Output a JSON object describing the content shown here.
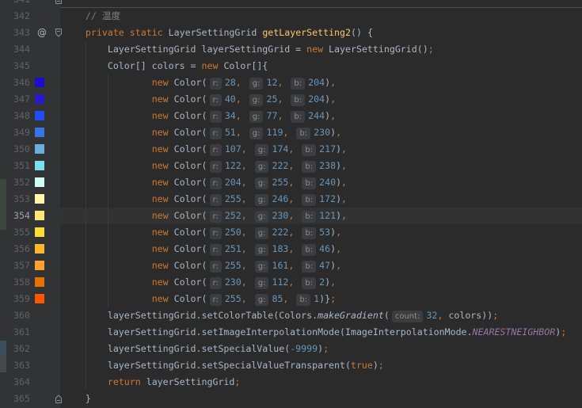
{
  "editor": {
    "current_line": "354",
    "colors": {
      "background": "#2B2B2B",
      "gutter": "#313335",
      "current_line_bg": "#323232",
      "line_number": "#606366",
      "current_line_number": "#A4A3A3",
      "hint_text": "#8C8C8C"
    },
    "syntax_colors": {
      "kw": "#CC7832",
      "punct": "#CC7832",
      "text": "#A9B7C6",
      "ws": "#A9B7C6",
      "num": "#6897BB",
      "comment": "#808080",
      "fn": "#FFC66D",
      "field": "#9876AA",
      "ital": "#A9B7C6",
      "hint": "#8C8C8C"
    },
    "lines": [
      {
        "num": "341",
        "fold": "fold-end-icon",
        "tokens": []
      },
      {
        "num": "342",
        "tokens": [
          [
            "ws",
            "    "
          ],
          [
            "comment",
            "// 温度"
          ]
        ]
      },
      {
        "num": "343",
        "gutter_icon": {
          "name": "at-icon",
          "glyph": "@"
        },
        "fold": "fold-start-icon",
        "tokens": [
          [
            "ws",
            "    "
          ],
          [
            "kw",
            "private"
          ],
          [
            "text",
            " "
          ],
          [
            "kw",
            "static"
          ],
          [
            "text",
            " LayerSettingGrid "
          ],
          [
            "fn",
            "getLayerSetting2"
          ],
          [
            "text",
            "() {"
          ]
        ]
      },
      {
        "num": "344",
        "tokens": [
          [
            "text",
            "        LayerSettingGrid layerSettingGrid = "
          ],
          [
            "kw",
            "new"
          ],
          [
            "text",
            " LayerSettingGrid()"
          ],
          [
            "punct",
            ";"
          ]
        ]
      },
      {
        "num": "345",
        "tokens": [
          [
            "text",
            "        Color[] colors = "
          ],
          [
            "kw",
            "new"
          ],
          [
            "text",
            " Color[]{"
          ]
        ]
      },
      {
        "num": "346",
        "swatch": "#1C0CCC",
        "tokens": [
          [
            "ws",
            "                "
          ],
          [
            "kw",
            "new"
          ],
          [
            "text",
            " Color("
          ],
          [
            "hint",
            "r:"
          ],
          [
            "num",
            "28"
          ],
          [
            "punct",
            ", "
          ],
          [
            "hint",
            "g:"
          ],
          [
            "num",
            "12"
          ],
          [
            "punct",
            ", "
          ],
          [
            "hint",
            "b:"
          ],
          [
            "num",
            "204"
          ],
          [
            "text",
            ")"
          ],
          [
            "punct",
            ","
          ]
        ]
      },
      {
        "num": "347",
        "swatch": "#2819CC",
        "tokens": [
          [
            "ws",
            "                "
          ],
          [
            "kw",
            "new"
          ],
          [
            "text",
            " Color("
          ],
          [
            "hint",
            "r:"
          ],
          [
            "num",
            "40"
          ],
          [
            "punct",
            ", "
          ],
          [
            "hint",
            "g:"
          ],
          [
            "num",
            "25"
          ],
          [
            "punct",
            ", "
          ],
          [
            "hint",
            "b:"
          ],
          [
            "num",
            "204"
          ],
          [
            "text",
            ")"
          ],
          [
            "punct",
            ","
          ]
        ]
      },
      {
        "num": "348",
        "swatch": "#224DF4",
        "tokens": [
          [
            "ws",
            "                "
          ],
          [
            "kw",
            "new"
          ],
          [
            "text",
            " Color("
          ],
          [
            "hint",
            "r:"
          ],
          [
            "num",
            "34"
          ],
          [
            "punct",
            ", "
          ],
          [
            "hint",
            "g:"
          ],
          [
            "num",
            "77"
          ],
          [
            "punct",
            ", "
          ],
          [
            "hint",
            "b:"
          ],
          [
            "num",
            "244"
          ],
          [
            "text",
            ")"
          ],
          [
            "punct",
            ","
          ]
        ]
      },
      {
        "num": "349",
        "swatch": "#3377E6",
        "tokens": [
          [
            "ws",
            "                "
          ],
          [
            "kw",
            "new"
          ],
          [
            "text",
            " Color("
          ],
          [
            "hint",
            "r:"
          ],
          [
            "num",
            "51"
          ],
          [
            "punct",
            ", "
          ],
          [
            "hint",
            "g:"
          ],
          [
            "num",
            "119"
          ],
          [
            "punct",
            ", "
          ],
          [
            "hint",
            "b:"
          ],
          [
            "num",
            "230"
          ],
          [
            "text",
            ")"
          ],
          [
            "punct",
            ","
          ]
        ]
      },
      {
        "num": "350",
        "swatch": "#6BAED9",
        "tokens": [
          [
            "ws",
            "                "
          ],
          [
            "kw",
            "new"
          ],
          [
            "text",
            " Color("
          ],
          [
            "hint",
            "r:"
          ],
          [
            "num",
            "107"
          ],
          [
            "punct",
            ", "
          ],
          [
            "hint",
            "g:"
          ],
          [
            "num",
            "174"
          ],
          [
            "punct",
            ", "
          ],
          [
            "hint",
            "b:"
          ],
          [
            "num",
            "217"
          ],
          [
            "text",
            ")"
          ],
          [
            "punct",
            ","
          ]
        ]
      },
      {
        "num": "351",
        "swatch": "#7ADEEE",
        "tokens": [
          [
            "ws",
            "                "
          ],
          [
            "kw",
            "new"
          ],
          [
            "text",
            " Color("
          ],
          [
            "hint",
            "r:"
          ],
          [
            "num",
            "122"
          ],
          [
            "punct",
            ", "
          ],
          [
            "hint",
            "g:"
          ],
          [
            "num",
            "222"
          ],
          [
            "punct",
            ", "
          ],
          [
            "hint",
            "b:"
          ],
          [
            "num",
            "238"
          ],
          [
            "text",
            ")"
          ],
          [
            "punct",
            ","
          ]
        ]
      },
      {
        "num": "352",
        "swatch": "#CCFFF0",
        "tokens": [
          [
            "ws",
            "                "
          ],
          [
            "kw",
            "new"
          ],
          [
            "text",
            " Color("
          ],
          [
            "hint",
            "r:"
          ],
          [
            "num",
            "204"
          ],
          [
            "punct",
            ", "
          ],
          [
            "hint",
            "g:"
          ],
          [
            "num",
            "255"
          ],
          [
            "punct",
            ", "
          ],
          [
            "hint",
            "b:"
          ],
          [
            "num",
            "240"
          ],
          [
            "text",
            ")"
          ],
          [
            "punct",
            ","
          ]
        ]
      },
      {
        "num": "353",
        "swatch": "#FFF6AC",
        "tokens": [
          [
            "ws",
            "                "
          ],
          [
            "kw",
            "new"
          ],
          [
            "text",
            " Color("
          ],
          [
            "hint",
            "r:"
          ],
          [
            "num",
            "255"
          ],
          [
            "punct",
            ", "
          ],
          [
            "hint",
            "g:"
          ],
          [
            "num",
            "246"
          ],
          [
            "punct",
            ", "
          ],
          [
            "hint",
            "b:"
          ],
          [
            "num",
            "172"
          ],
          [
            "text",
            ")"
          ],
          [
            "punct",
            ","
          ]
        ]
      },
      {
        "num": "354",
        "swatch": "#FCE679",
        "tokens": [
          [
            "ws",
            "                "
          ],
          [
            "kw",
            "new"
          ],
          [
            "text",
            " Color("
          ],
          [
            "hint",
            "r:"
          ],
          [
            "num",
            "252"
          ],
          [
            "punct",
            ", "
          ],
          [
            "hint",
            "g:"
          ],
          [
            "num",
            "230"
          ],
          [
            "punct",
            ", "
          ],
          [
            "hint",
            "b:"
          ],
          [
            "num",
            "121"
          ],
          [
            "text",
            ")"
          ],
          [
            "punct",
            ","
          ]
        ]
      },
      {
        "num": "355",
        "swatch": "#FADE35",
        "tokens": [
          [
            "ws",
            "                "
          ],
          [
            "kw",
            "new"
          ],
          [
            "text",
            " Color("
          ],
          [
            "hint",
            "r:"
          ],
          [
            "num",
            "250"
          ],
          [
            "punct",
            ", "
          ],
          [
            "hint",
            "g:"
          ],
          [
            "num",
            "222"
          ],
          [
            "punct",
            ", "
          ],
          [
            "hint",
            "b:"
          ],
          [
            "num",
            "53"
          ],
          [
            "text",
            ")"
          ],
          [
            "punct",
            ","
          ]
        ]
      },
      {
        "num": "356",
        "swatch": "#FBB72E",
        "tokens": [
          [
            "ws",
            "                "
          ],
          [
            "kw",
            "new"
          ],
          [
            "text",
            " Color("
          ],
          [
            "hint",
            "r:"
          ],
          [
            "num",
            "251"
          ],
          [
            "punct",
            ", "
          ],
          [
            "hint",
            "g:"
          ],
          [
            "num",
            "183"
          ],
          [
            "punct",
            ", "
          ],
          [
            "hint",
            "b:"
          ],
          [
            "num",
            "46"
          ],
          [
            "text",
            ")"
          ],
          [
            "punct",
            ","
          ]
        ]
      },
      {
        "num": "357",
        "swatch": "#FFA12F",
        "tokens": [
          [
            "ws",
            "                "
          ],
          [
            "kw",
            "new"
          ],
          [
            "text",
            " Color("
          ],
          [
            "hint",
            "r:"
          ],
          [
            "num",
            "255"
          ],
          [
            "punct",
            ", "
          ],
          [
            "hint",
            "g:"
          ],
          [
            "num",
            "161"
          ],
          [
            "punct",
            ", "
          ],
          [
            "hint",
            "b:"
          ],
          [
            "num",
            "47"
          ],
          [
            "text",
            ")"
          ],
          [
            "punct",
            ","
          ]
        ]
      },
      {
        "num": "358",
        "swatch": "#E67002",
        "tokens": [
          [
            "ws",
            "                "
          ],
          [
            "kw",
            "new"
          ],
          [
            "text",
            " Color("
          ],
          [
            "hint",
            "r:"
          ],
          [
            "num",
            "230"
          ],
          [
            "punct",
            ", "
          ],
          [
            "hint",
            "g:"
          ],
          [
            "num",
            "112"
          ],
          [
            "punct",
            ", "
          ],
          [
            "hint",
            "b:"
          ],
          [
            "num",
            "2"
          ],
          [
            "text",
            ")"
          ],
          [
            "punct",
            ","
          ]
        ]
      },
      {
        "num": "359",
        "swatch": "#FF5501",
        "tokens": [
          [
            "ws",
            "                "
          ],
          [
            "kw",
            "new"
          ],
          [
            "text",
            " Color("
          ],
          [
            "hint",
            "r:"
          ],
          [
            "num",
            "255"
          ],
          [
            "punct",
            ", "
          ],
          [
            "hint",
            "g:"
          ],
          [
            "num",
            "85"
          ],
          [
            "punct",
            ", "
          ],
          [
            "hint",
            "b:"
          ],
          [
            "num",
            "1"
          ],
          [
            "text",
            ")}"
          ],
          [
            "punct",
            ";"
          ]
        ]
      },
      {
        "num": "360",
        "tokens": [
          [
            "text",
            "        layerSettingGrid.setColorTable(Colors."
          ],
          [
            "ital",
            "makeGradient"
          ],
          [
            "text",
            "("
          ],
          [
            "hint",
            "count:"
          ],
          [
            "num",
            "32"
          ],
          [
            "punct",
            ", "
          ],
          [
            "text",
            "colors))"
          ],
          [
            "punct",
            ";"
          ]
        ]
      },
      {
        "num": "361",
        "tokens": [
          [
            "text",
            "        layerSettingGrid.setImageInterpolationMode(ImageInterpolationMode."
          ],
          [
            "field",
            "NEARESTNEIGHBOR"
          ],
          [
            "text",
            ")"
          ],
          [
            "punct",
            ";"
          ]
        ]
      },
      {
        "num": "362",
        "tokens": [
          [
            "text",
            "        layerSettingGrid.setSpecialValue("
          ],
          [
            "num",
            "-9999"
          ],
          [
            "text",
            ")"
          ],
          [
            "punct",
            ";"
          ]
        ]
      },
      {
        "num": "363",
        "tokens": [
          [
            "text",
            "        layerSettingGrid.setSpecialValueTransparent("
          ],
          [
            "kw",
            "true"
          ],
          [
            "text",
            ")"
          ],
          [
            "punct",
            ";"
          ]
        ]
      },
      {
        "num": "364",
        "tokens": [
          [
            "ws",
            "        "
          ],
          [
            "kw",
            "return"
          ],
          [
            "text",
            " layerSettingGrid"
          ],
          [
            "punct",
            ";"
          ]
        ]
      },
      {
        "num": "365",
        "fold": "fold-end-icon",
        "tokens": [
          [
            "text",
            "    }"
          ]
        ]
      }
    ]
  }
}
